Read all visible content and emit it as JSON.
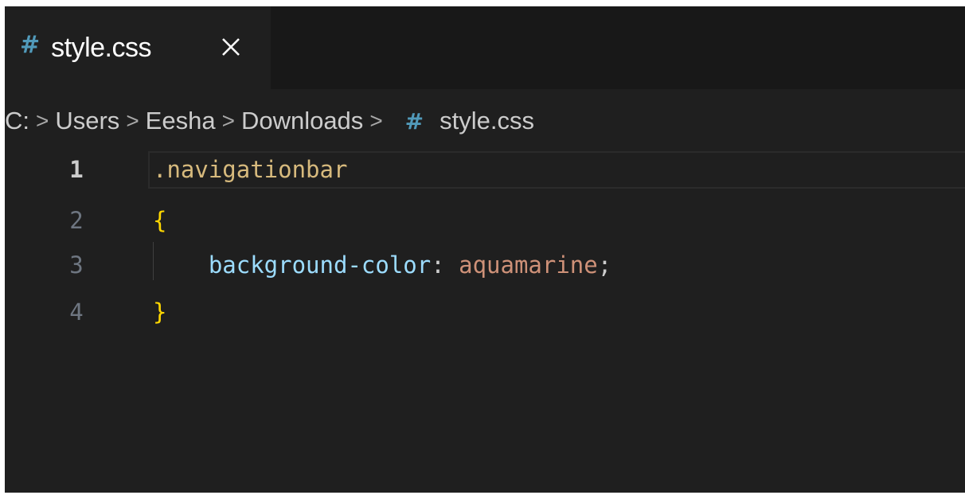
{
  "tab": {
    "icon": "#",
    "label": "style.css",
    "close_icon": "close-icon"
  },
  "breadcrumb": {
    "items": [
      "C:",
      "Users",
      "Eesha",
      "Downloads"
    ],
    "separator": ">",
    "file_icon": "#",
    "file_label": "style.css"
  },
  "editor": {
    "lines": [
      {
        "number": "1",
        "tokens": [
          {
            "text": ".navigationbar",
            "kind": "selector"
          }
        ]
      },
      {
        "number": "2",
        "tokens": [
          {
            "text": "{",
            "kind": "brace"
          }
        ]
      },
      {
        "number": "3",
        "tokens": [
          {
            "text": "    ",
            "kind": "punct"
          },
          {
            "text": "background-color",
            "kind": "prop"
          },
          {
            "text": ": ",
            "kind": "punct"
          },
          {
            "text": "aquamarine",
            "kind": "value"
          },
          {
            "text": ";",
            "kind": "punct"
          }
        ]
      },
      {
        "number": "4",
        "tokens": [
          {
            "text": "}",
            "kind": "brace"
          }
        ]
      }
    ]
  },
  "colors": {
    "editor_bg": "#1f1f1f",
    "tabbar_bg": "#181818",
    "css_icon": "#519aba",
    "selector": "#d7ba7d",
    "brace": "#ffd700",
    "property": "#9cdcfe",
    "value": "#ce9178"
  }
}
